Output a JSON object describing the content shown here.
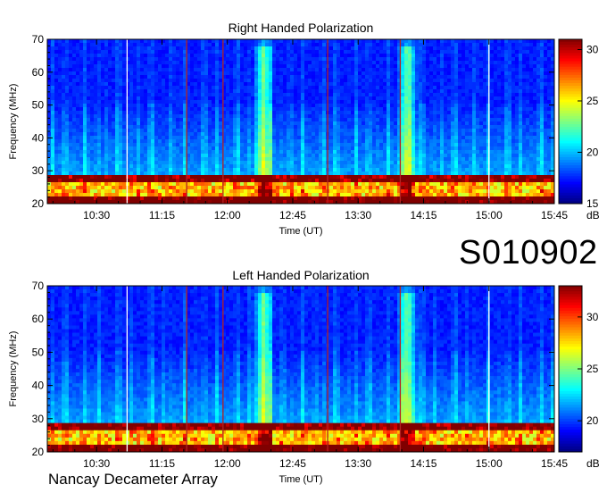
{
  "observation_id": "S010902",
  "instrument": "Nancay Decameter Array",
  "colorbar_unit": "dB",
  "colors": {
    "low": "#00008f",
    "mid": "#3fbfff",
    "high": "#ffff00",
    "max": "#800000",
    "marker_white": "#ffffff",
    "marker_red": "#b22222"
  },
  "chart_data": [
    {
      "type": "heatmap",
      "title": "Right Handed Polarization",
      "xlabel": "Time (UT)",
      "ylabel": "Frequency (MHz)",
      "x_ticks": [
        "10:30",
        "11:15",
        "12:00",
        "12:45",
        "13:30",
        "14:15",
        "15:00",
        "15:45"
      ],
      "y_ticks": [
        20,
        30,
        40,
        50,
        60,
        70
      ],
      "ylim": [
        20,
        70
      ],
      "colorbar": {
        "range": [
          15,
          31
        ],
        "ticks": [
          15,
          20,
          25,
          30
        ],
        "unit": "dB"
      },
      "vertical_markers": [
        {
          "time": "10:51",
          "color": "white"
        },
        {
          "time": "11:32",
          "color": "red"
        },
        {
          "time": "11:57",
          "color": "red"
        },
        {
          "time": "13:09",
          "color": "red"
        },
        {
          "time": "13:59",
          "color": "red"
        },
        {
          "time": "15:00",
          "color": "white"
        }
      ],
      "features": [
        {
          "kind": "burst",
          "time": "12:25",
          "freq_range": [
            20,
            70
          ]
        },
        {
          "kind": "burst",
          "time": "14:04",
          "freq_range": [
            20,
            50
          ]
        },
        {
          "kind": "interference_band",
          "freq_range": [
            20,
            28
          ]
        }
      ]
    },
    {
      "type": "heatmap",
      "title": "Left Handed Polarization",
      "xlabel": "Time (UT)",
      "ylabel": "Frequency (MHz)",
      "x_ticks": [
        "10:30",
        "11:15",
        "12:00",
        "12:45",
        "13:30",
        "14:15",
        "15:00",
        "15:45"
      ],
      "y_ticks": [
        20,
        30,
        40,
        50,
        60,
        70
      ],
      "ylim": [
        20,
        70
      ],
      "colorbar": {
        "range": [
          17,
          33
        ],
        "ticks": [
          20,
          25,
          30
        ],
        "unit": "dB"
      },
      "vertical_markers": [
        {
          "time": "10:51",
          "color": "white"
        },
        {
          "time": "11:32",
          "color": "red"
        },
        {
          "time": "11:57",
          "color": "red"
        },
        {
          "time": "13:09",
          "color": "red"
        },
        {
          "time": "13:59",
          "color": "red"
        },
        {
          "time": "15:00",
          "color": "white"
        }
      ],
      "features": [
        {
          "kind": "burst",
          "time": "12:25",
          "freq_range": [
            20,
            70
          ]
        },
        {
          "kind": "burst",
          "time": "14:04",
          "freq_range": [
            20,
            50
          ]
        },
        {
          "kind": "interference_band",
          "freq_range": [
            20,
            28
          ]
        }
      ]
    }
  ]
}
